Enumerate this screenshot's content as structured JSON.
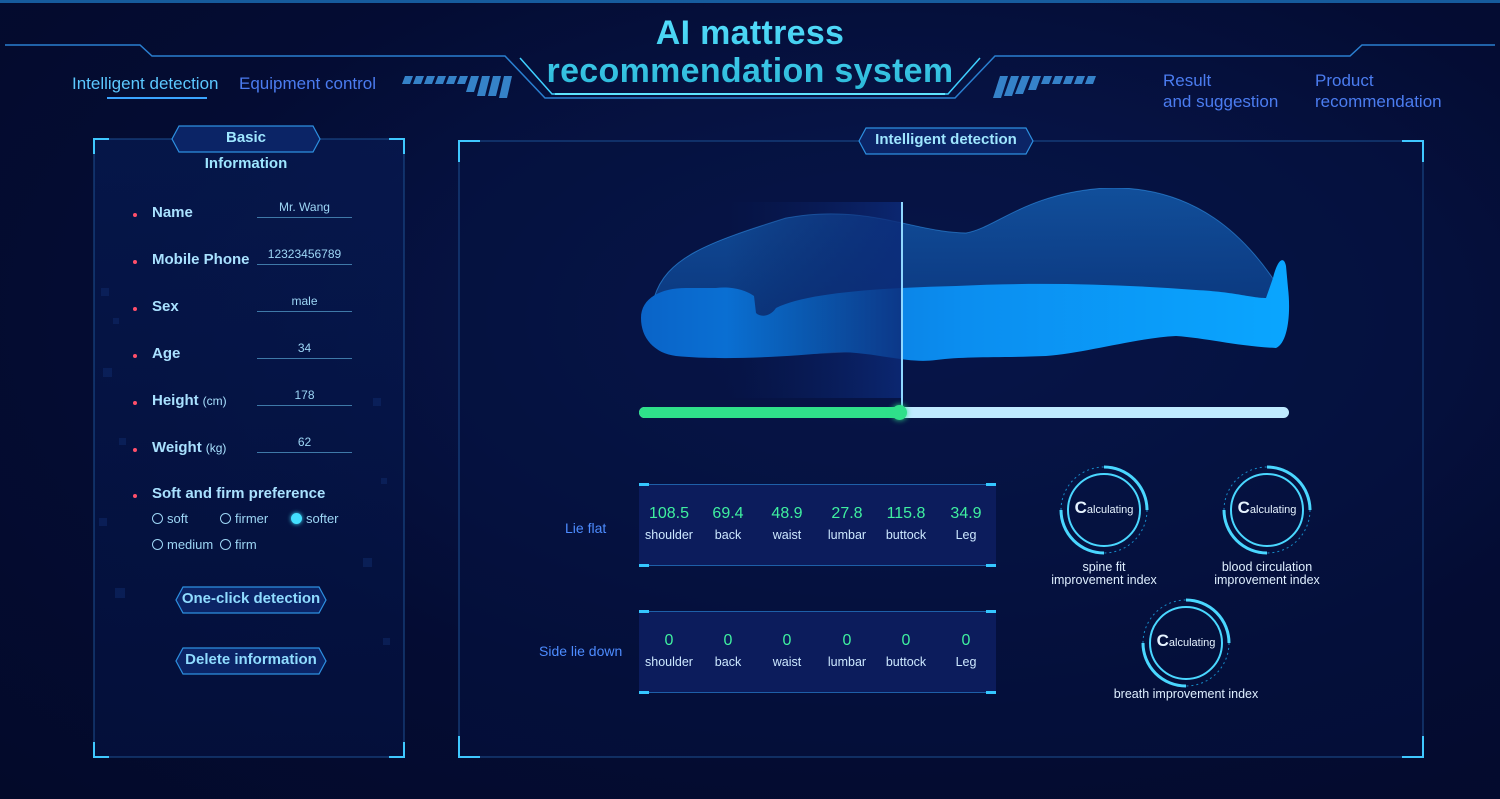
{
  "header": {
    "title_line1": "AI mattress",
    "title_line2": "recommendation system",
    "nav_left": [
      "Intelligent detection",
      "Equipment control"
    ],
    "nav_right": [
      {
        "line1": "Result",
        "line2": "and suggestion"
      },
      {
        "line1": "Product",
        "line2": "recommendation"
      }
    ]
  },
  "basic_info": {
    "title": "Basic Information",
    "fields": [
      {
        "label": "Name",
        "unit": "",
        "value": "Mr. Wang"
      },
      {
        "label": "Mobile Phone",
        "unit": "",
        "value": "12323456789"
      },
      {
        "label": "Sex",
        "unit": "",
        "value": "male"
      },
      {
        "label": "Age",
        "unit": "",
        "value": "34"
      },
      {
        "label": "Height",
        "unit": "(cm)",
        "value": "178"
      },
      {
        "label": "Weight",
        "unit": "(kg)",
        "value": "62"
      }
    ],
    "preference_label": "Soft and firm preference",
    "preference_options": [
      "soft",
      "firmer",
      "softer",
      "medium",
      "firm"
    ],
    "preference_selected": "softer",
    "one_click_label": "One-click detection",
    "delete_label": "Delete information"
  },
  "detection": {
    "title": "Intelligent detection",
    "scan_progress": 0.4,
    "lie_flat": {
      "label": "Lie flat",
      "metrics": [
        {
          "value": "108.5",
          "label": "shoulder"
        },
        {
          "value": "69.4",
          "label": "back"
        },
        {
          "value": "48.9",
          "label": "waist"
        },
        {
          "value": "27.8",
          "label": "lumbar"
        },
        {
          "value": "115.8",
          "label": "buttock"
        },
        {
          "value": "34.9",
          "label": "Leg"
        }
      ]
    },
    "side_lie": {
      "label": "Side lie down",
      "metrics": [
        {
          "value": "0",
          "label": "shoulder"
        },
        {
          "value": "0",
          "label": "back"
        },
        {
          "value": "0",
          "label": "waist"
        },
        {
          "value": "0",
          "label": "lumbar"
        },
        {
          "value": "0",
          "label": "buttock"
        },
        {
          "value": "0",
          "label": "Leg"
        }
      ]
    },
    "gauges": [
      {
        "big": "C",
        "rest": "alculating",
        "caption_line1": "spine fit",
        "caption_line2": "improvement index"
      },
      {
        "big": "C",
        "rest": "alculating",
        "caption_line1": "blood circulation",
        "caption_line2": "improvement index"
      },
      {
        "big": "C",
        "rest": "alculating",
        "caption_line1": "breath improvement index",
        "caption_line2": ""
      }
    ]
  },
  "colors": {
    "accent": "#35c7ff",
    "progress": "#2fe08a",
    "track": "#bfeaff",
    "metric_value": "#3ff0a0",
    "required_dot": "#ff4f6a"
  }
}
